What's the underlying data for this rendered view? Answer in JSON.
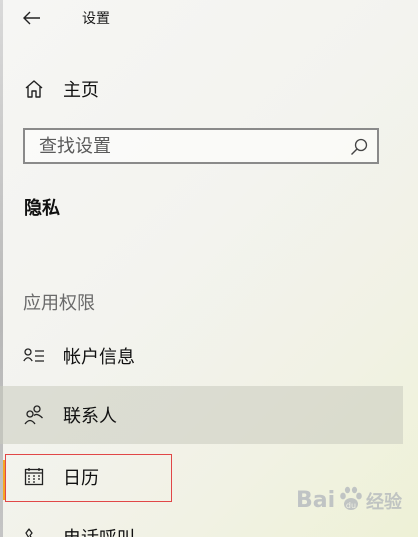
{
  "window": {
    "title": "设置"
  },
  "nav": {
    "home_label": "主页"
  },
  "search": {
    "placeholder": "查找设置"
  },
  "section": {
    "heading": "隐私"
  },
  "app_permissions": {
    "header": "应用权限",
    "items": [
      {
        "label": "帐户信息",
        "icon": "account-info-icon"
      },
      {
        "label": "联系人",
        "icon": "contacts-icon",
        "selected": true
      },
      {
        "label": "日历",
        "icon": "calendar-icon",
        "highlighted": true
      },
      {
        "label": "电话呼叫",
        "icon": "phone-icon"
      }
    ]
  },
  "watermark": {
    "brand": "Bai",
    "suffix": "经验"
  },
  "colors": {
    "highlight_border": "#e14747",
    "selected_bg": "#c8cabe",
    "accent": "#f5a623"
  }
}
